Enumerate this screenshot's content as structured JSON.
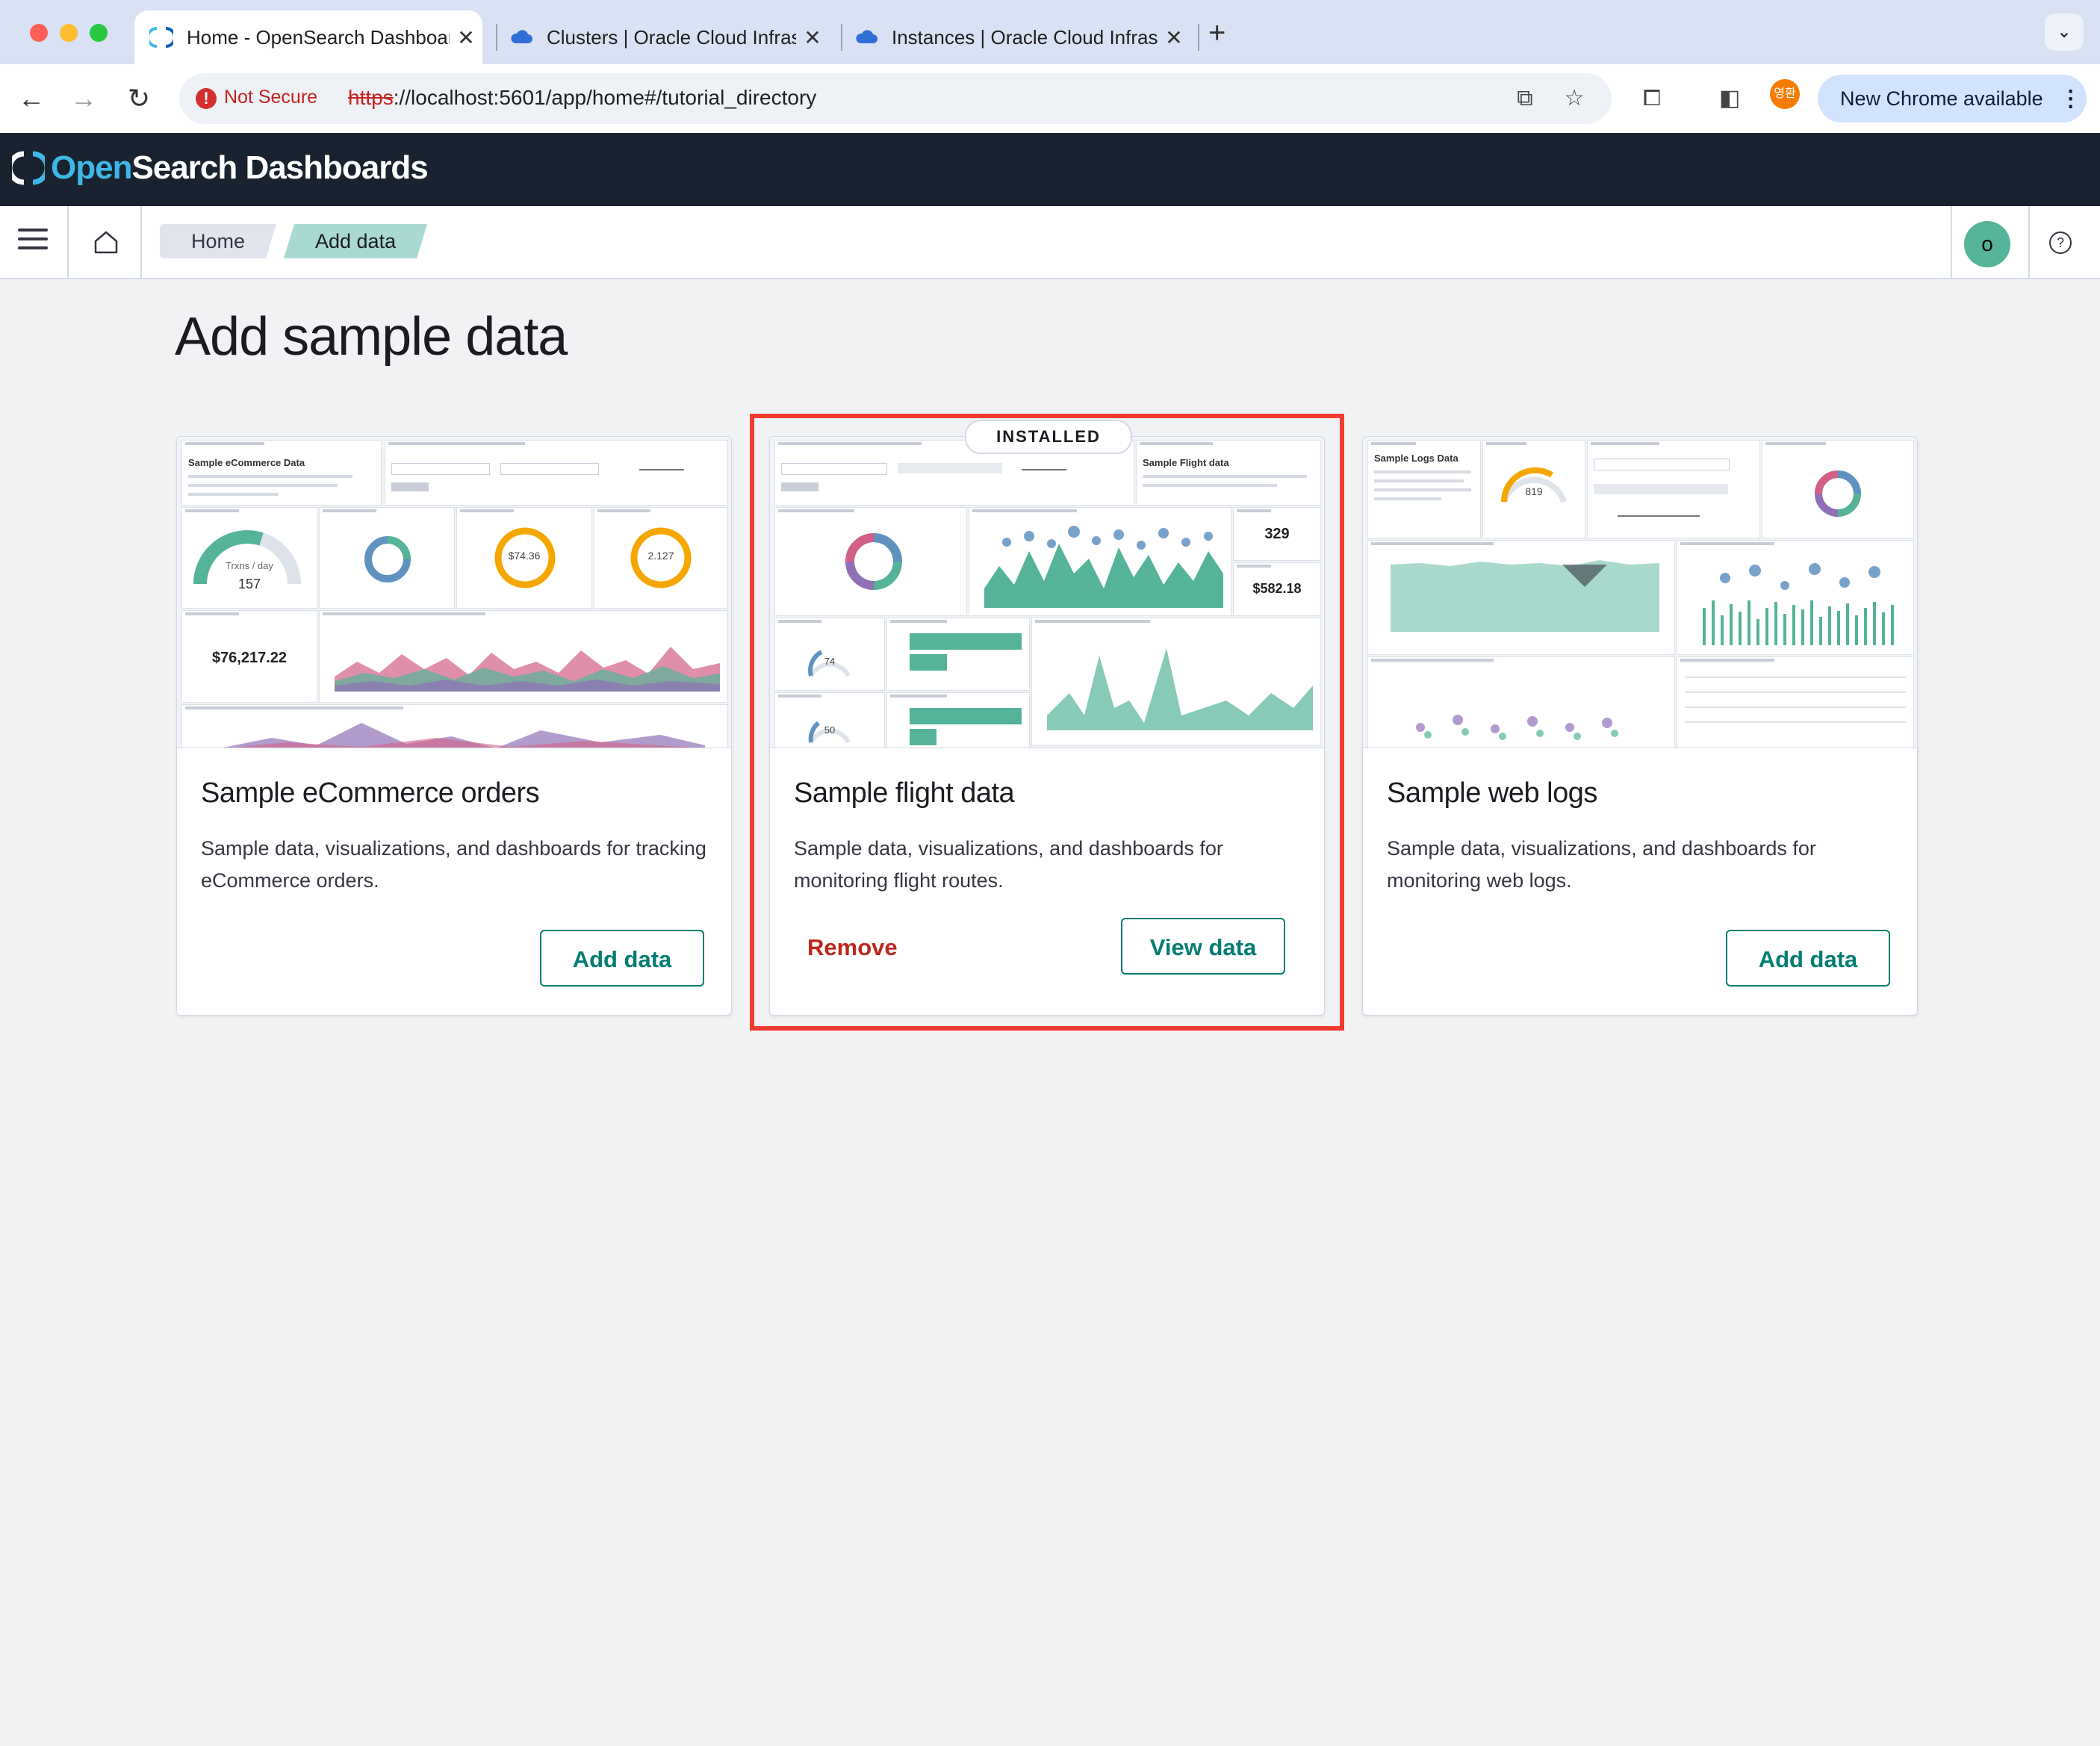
{
  "browser": {
    "tabs": [
      {
        "title": "Home - OpenSearch Dashboards",
        "active": true
      },
      {
        "title": "Clusters | Oracle Cloud Infrastructure",
        "active": false
      },
      {
        "title": "Instances | Oracle Cloud Infrastructure",
        "active": false
      }
    ],
    "new_tab_icon": "plus-icon",
    "security_label": "Not Secure",
    "url_scheme": "https",
    "url_rest": "://localhost:5601/app/home#/tutorial_directory",
    "profile_badge": "영환",
    "update_label": "New Chrome available"
  },
  "app": {
    "logo_open": "Open",
    "logo_rest": "Search Dashboards"
  },
  "breadcrumbs": [
    "Home",
    "Add data"
  ],
  "user_avatar": "o",
  "page": {
    "title": "Add sample data"
  },
  "cards": [
    {
      "title": "Sample eCommerce orders",
      "description": "Sample data, visualizations, and dashboards for tracking eCommerce orders.",
      "primary_action": "Add data",
      "installed": false,
      "thumb": {
        "metric_a": "Trxns / day",
        "metric_a_value": "157",
        "price": "$74.36",
        "qty": "2.127",
        "revenue": "$76,217.22",
        "heading": "Sample eCommerce Data"
      }
    },
    {
      "title": "Sample flight data",
      "description": "Sample data, visualizations, and dashboards for monitoring flight routes.",
      "primary_action": "View data",
      "secondary_action": "Remove",
      "installed": true,
      "badge": "INSTALLED",
      "thumb": {
        "total_flights": "329",
        "avg_ticket": "$582.18",
        "delays": "74",
        "cancellations": "50",
        "heading": "Sample Flight data"
      }
    },
    {
      "title": "Sample web logs",
      "description": "Sample data, visualizations, and dashboards for monitoring web logs.",
      "primary_action": "Add data",
      "installed": false,
      "thumb": {
        "visitors": "819",
        "heading": "Sample Logs Data"
      }
    }
  ],
  "colors": {
    "accent": "#017d73",
    "danger": "#bd271e",
    "header_bg": "#18232f",
    "highlight": "#f43b2f",
    "chart_green": "#54b399"
  }
}
